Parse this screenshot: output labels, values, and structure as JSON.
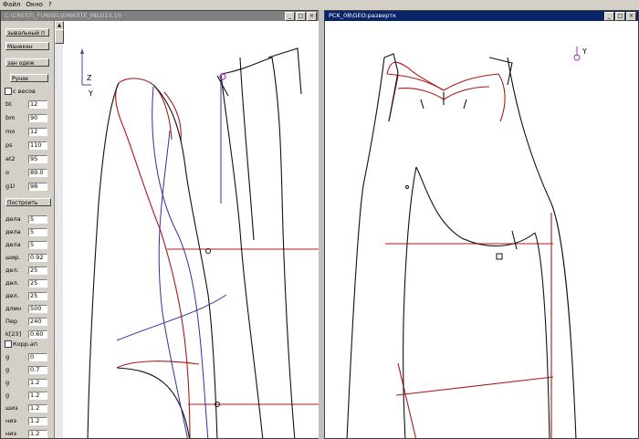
{
  "menu": {
    "items": [
      "Файл",
      "Окно",
      "?"
    ]
  },
  "colors": {
    "active_title": "#0a246a",
    "inactive_title": "#808080",
    "pattern_red": "#b01818",
    "pattern_black": "#111111",
    "pattern_blue": "#3030a0"
  },
  "left_window": {
    "title": "C:\\CREST\\_FUNSEL\\ЕМИЛТЕ_INLG13.10",
    "buttons": [
      "_",
      "□",
      "×"
    ]
  },
  "right_window": {
    "title": "PCK_08\\GEO:развертк",
    "buttons": [
      "_",
      "□",
      "×"
    ]
  },
  "panel": {
    "top_buttons": [
      "зывальный п",
      "Манекен",
      "зан одеж",
      "Рунак"
    ],
    "checkbox1": "с весов",
    "params": [
      {
        "label": "bt",
        "value": "12"
      },
      {
        "label": "bm",
        "value": "90"
      },
      {
        "label": "mo",
        "value": "12"
      },
      {
        "label": "ps",
        "value": "110"
      },
      {
        "label": "at2",
        "value": "95"
      },
      {
        "label": "o",
        "value": "89.0"
      },
      {
        "label": "g1l",
        "value": "98"
      }
    ],
    "build_button": "Построить",
    "divisions": [
      {
        "label": "дела",
        "value": "5"
      },
      {
        "label": "дела",
        "value": "5"
      },
      {
        "label": "дела",
        "value": "5"
      },
      {
        "label": "шир.",
        "value": "0.92"
      },
      {
        "label": "дел.",
        "value": "25"
      },
      {
        "label": "дел.",
        "value": "25"
      },
      {
        "label": "дел.",
        "value": "25"
      },
      {
        "label": "длин",
        "value": "500"
      },
      {
        "label": "Пер",
        "value": "240"
      },
      {
        "label": "k[23]",
        "value": "0.60"
      }
    ],
    "checkbox2": "Корр.ап",
    "coefs": [
      {
        "label": "g",
        "value": "0"
      },
      {
        "label": "g",
        "value": "0.7"
      },
      {
        "label": "g",
        "value": "1.2"
      },
      {
        "label": "g",
        "value": "1.2"
      },
      {
        "label": "шиз",
        "value": "1.2"
      },
      {
        "label": "ниэ",
        "value": "1.2"
      },
      {
        "label": "ниэ",
        "value": "1.2"
      }
    ]
  },
  "axes_left": {
    "z": "Z",
    "y": "Y"
  },
  "axes_right": {
    "y": "Y"
  }
}
